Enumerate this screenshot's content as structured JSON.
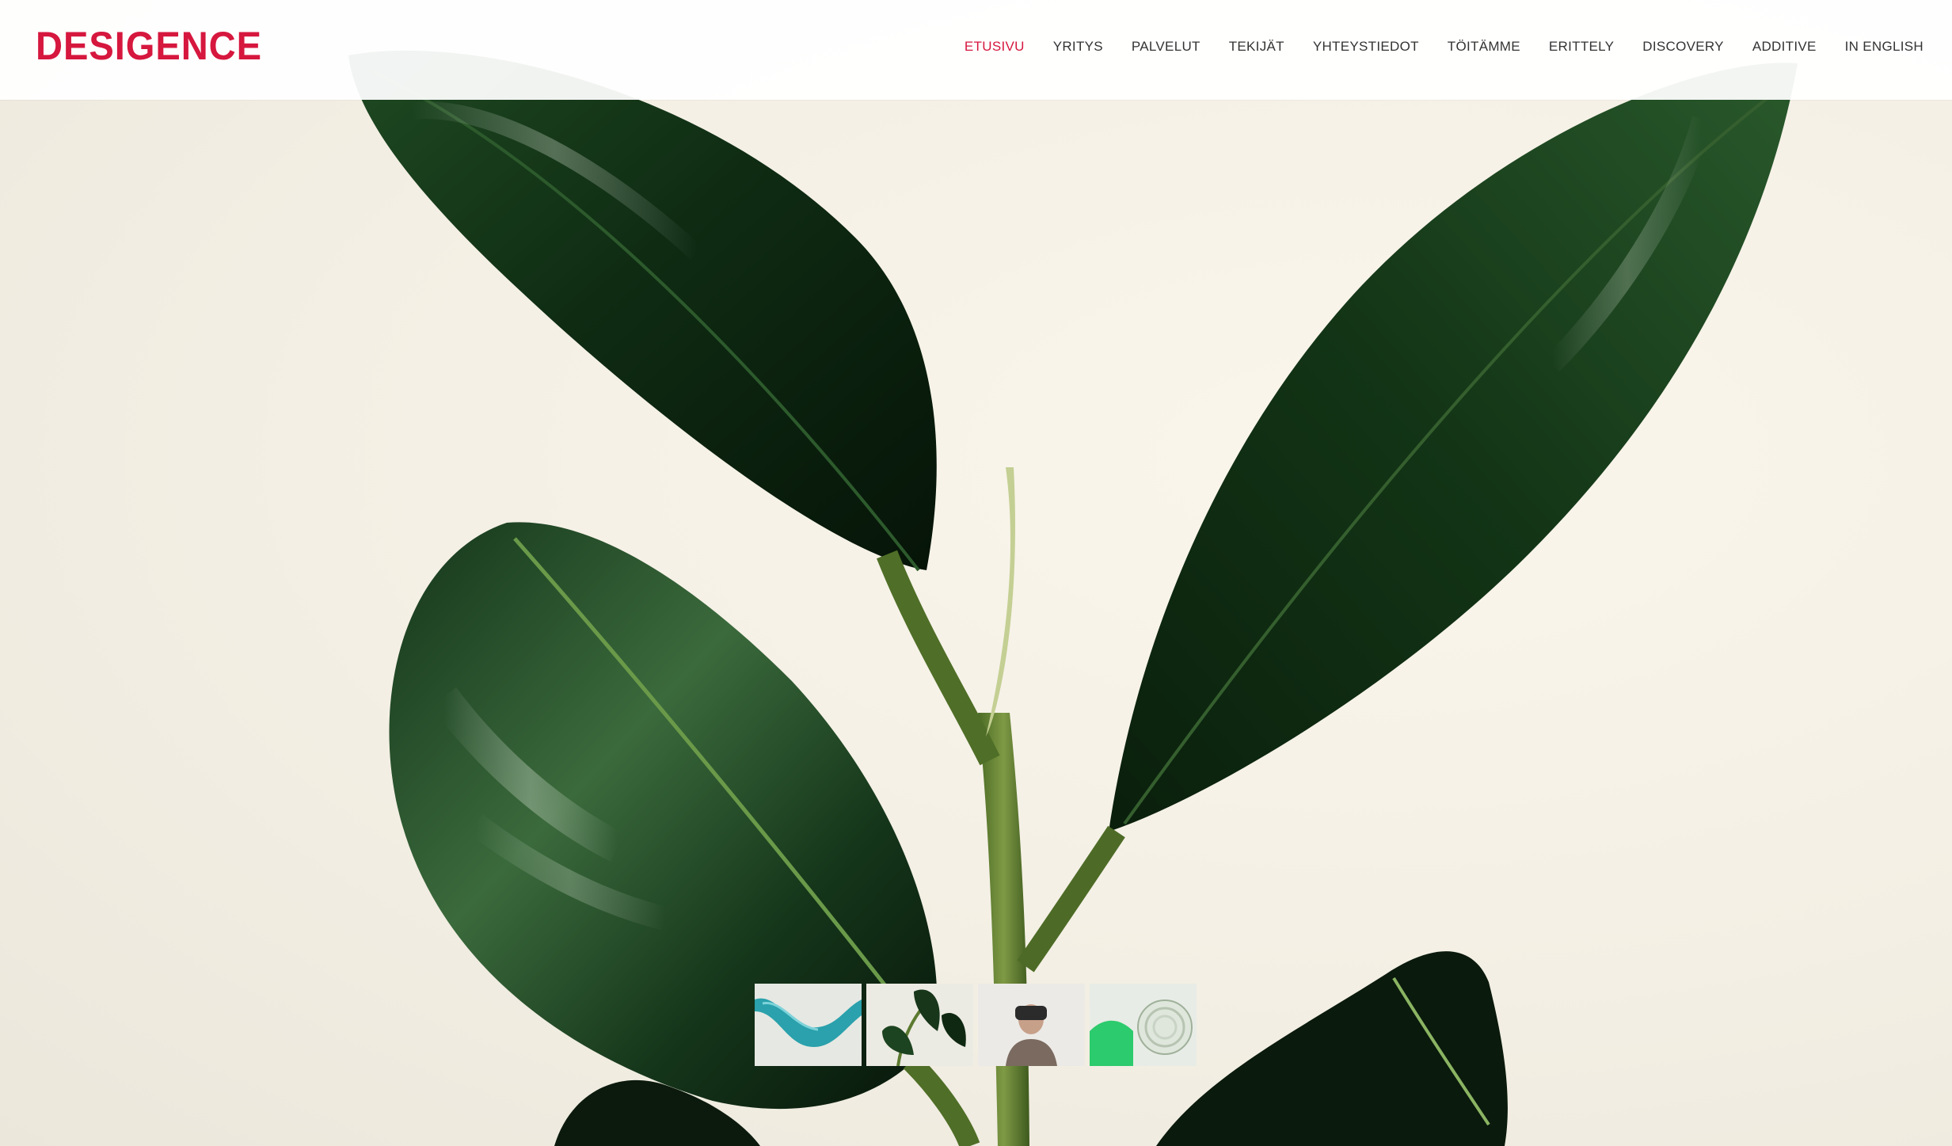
{
  "brand": {
    "logo_text": "DESIGENCE",
    "logo_color": "#d6173e"
  },
  "nav": {
    "active_color": "#d6173e",
    "items": [
      {
        "label": "ETUSIVU",
        "active": true
      },
      {
        "label": "YRITYS"
      },
      {
        "label": "PALVELUT"
      },
      {
        "label": "TEKIJÄT"
      },
      {
        "label": "YHTEYSTIEDOT"
      },
      {
        "label": "TÖITÄMME"
      },
      {
        "label": "ERITTELY"
      },
      {
        "label": "DISCOVERY"
      },
      {
        "label": "ADDITIVE"
      },
      {
        "label": "IN ENGLISH"
      }
    ]
  },
  "hero": {
    "image": "rubber-plant-leaves-photo"
  },
  "slider": {
    "thumbnails": [
      {
        "name": "teal-wave-thumbnail"
      },
      {
        "name": "plant-leaves-thumbnail",
        "active": true
      },
      {
        "name": "person-with-headset-thumbnail"
      },
      {
        "name": "green-product-thumbnail"
      }
    ]
  }
}
